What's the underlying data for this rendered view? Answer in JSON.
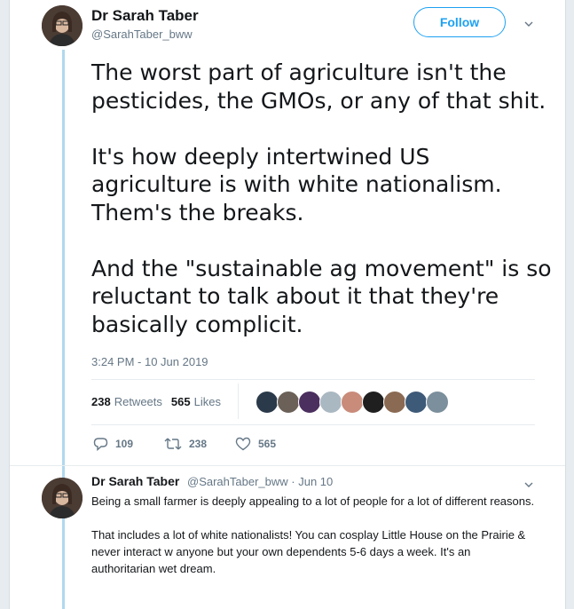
{
  "tweet": {
    "author_name": "Dr Sarah Taber",
    "author_handle": "@SarahTaber_bww",
    "follow_label": "Follow",
    "text": "The worst part of agriculture isn't the pesticides, the GMOs, or any of that shit.\n\nIt's how deeply intertwined US agriculture is with white nationalism. Them's the breaks.\n\nAnd the \"sustainable ag movement\" is so reluctant to talk about it that they're basically complicit.",
    "timestamp": "3:24 PM - 10 Jun 2019",
    "retweet_count": "238",
    "retweet_label": "Retweets",
    "like_count": "565",
    "like_label": "Likes",
    "actions": {
      "replies": "109",
      "retweets": "238",
      "likes": "565"
    },
    "likers": [
      {
        "name": "liker-1",
        "color": "#2b3a4a"
      },
      {
        "name": "liker-2",
        "color": "#6b6158"
      },
      {
        "name": "liker-3",
        "color": "#4b2f5e"
      },
      {
        "name": "liker-4",
        "color": "#aab8c2"
      },
      {
        "name": "liker-5",
        "color": "#c98b7a"
      },
      {
        "name": "liker-6",
        "color": "#1f1f1f"
      },
      {
        "name": "liker-7",
        "color": "#8a6a52"
      },
      {
        "name": "liker-8",
        "color": "#3d5a78"
      },
      {
        "name": "liker-9",
        "color": "#7b8f9c"
      }
    ]
  },
  "reply": {
    "author_name": "Dr Sarah Taber",
    "author_handle": "@SarahTaber_bww",
    "date": "· Jun 10",
    "paragraphs": [
      "Being a small farmer is deeply appealing to a lot of people for a lot of different reasons.",
      "That includes a lot of white nationalists! You can cosplay Little House on the Prairie & never interact w anyone but your own dependents 5-6 days a week. It's an authoritarian wet dream."
    ]
  },
  "colors": {
    "accent": "#1da1f2",
    "thread_line": "#b0d8ee",
    "muted": "#657786"
  }
}
